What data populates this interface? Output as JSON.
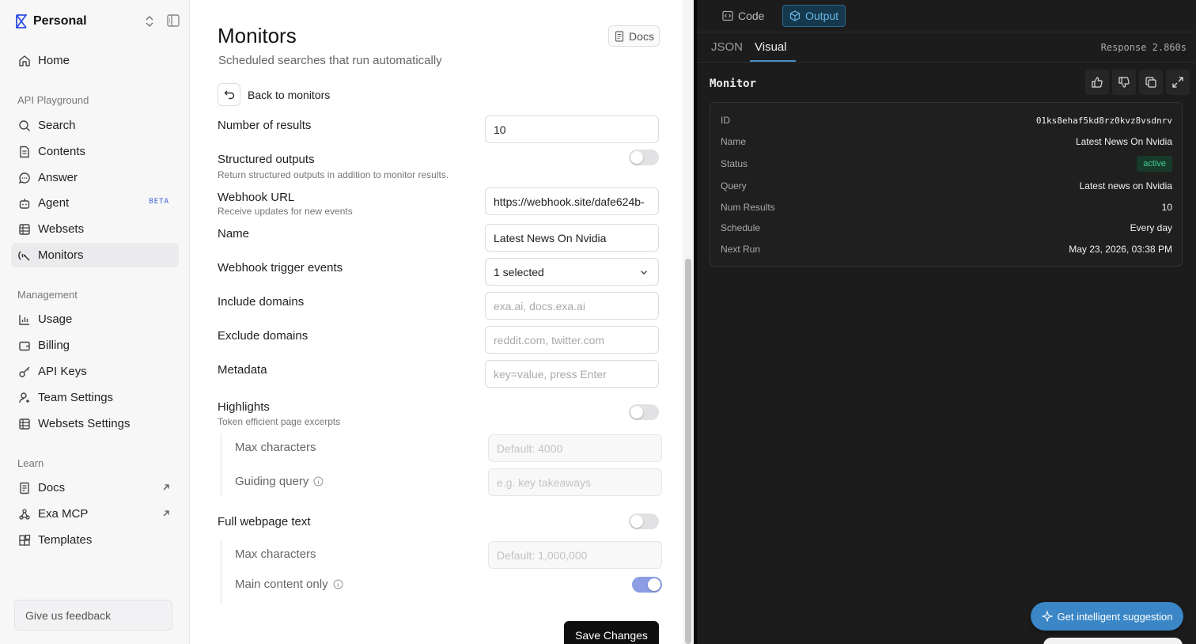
{
  "sidebar": {
    "workspace": "Personal",
    "home": "Home",
    "sections": {
      "api_playground": "API Playground",
      "management": "Management",
      "learn": "Learn"
    },
    "playground_items": [
      {
        "label": "Search"
      },
      {
        "label": "Contents"
      },
      {
        "label": "Answer"
      },
      {
        "label": "Agent",
        "badge": "BETA"
      },
      {
        "label": "Websets"
      },
      {
        "label": "Monitors",
        "active": true
      }
    ],
    "management_items": [
      {
        "label": "Usage"
      },
      {
        "label": "Billing"
      },
      {
        "label": "API Keys"
      },
      {
        "label": "Team Settings"
      },
      {
        "label": "Websets Settings"
      }
    ],
    "learn_items": [
      {
        "label": "Docs"
      },
      {
        "label": "Exa MCP"
      },
      {
        "label": "Templates"
      }
    ],
    "feedback": "Give us feedback"
  },
  "main": {
    "title": "Monitors",
    "subtitle": "Scheduled searches that run automatically",
    "docs_button": "Docs",
    "back_label": "Back to monitors",
    "num_results": {
      "label": "Number of results",
      "value": "10"
    },
    "structured_outputs": {
      "label": "Structured outputs",
      "hint": "Return structured outputs in addition to monitor results.",
      "enabled": false
    },
    "webhook_url": {
      "label": "Webhook URL",
      "hint": "Receive updates for new events",
      "value": "https://webhook.site/dafe624b-"
    },
    "name": {
      "label": "Name",
      "value": "Latest News On Nvidia"
    },
    "trigger_events": {
      "label": "Webhook trigger events",
      "value": "1 selected"
    },
    "include_domains": {
      "label": "Include domains",
      "placeholder": "exa.ai, docs.exa.ai"
    },
    "exclude_domains": {
      "label": "Exclude domains",
      "placeholder": "reddit.com, twitter.com"
    },
    "metadata": {
      "label": "Metadata",
      "placeholder": "key=value, press Enter"
    },
    "highlights": {
      "label": "Highlights",
      "hint": "Token efficient page excerpts",
      "enabled": false,
      "max_chars_label": "Max characters",
      "max_chars_placeholder": "Default: 4000",
      "guiding_query_label": "Guiding query",
      "guiding_query_placeholder": "e.g. key takeaways"
    },
    "full_text": {
      "label": "Full webpage text",
      "enabled": false,
      "max_chars_label": "Max characters",
      "max_chars_placeholder": "Default: 1,000,000",
      "main_content_label": "Main content only",
      "main_content_enabled": true
    },
    "save_button": "Save Changes"
  },
  "output": {
    "tabs": {
      "code": "Code",
      "output": "Output"
    },
    "subtabs": {
      "json": "JSON",
      "visual": "Visual"
    },
    "response": "Response 2.860s",
    "card_title": "Monitor",
    "fields": {
      "id": {
        "key": "ID",
        "value": "01ks8ehaf5kd8rz0kvz8vsdnrv"
      },
      "name": {
        "key": "Name",
        "value": "Latest News On Nvidia"
      },
      "status": {
        "key": "Status",
        "value": "active"
      },
      "query": {
        "key": "Query",
        "value": "Latest news on Nvidia"
      },
      "num_results": {
        "key": "Num Results",
        "value": "10"
      },
      "schedule": {
        "key": "Schedule",
        "value": "Every day"
      },
      "next_run": {
        "key": "Next Run",
        "value": "May 23, 2026, 03:38 PM"
      }
    },
    "suggestion_button": "Get intelligent suggestion"
  },
  "colors": {
    "accent_blue": "#3b5bdb",
    "panel_bg": "#1c1c1c",
    "status_green": "#3ed08a",
    "suggest_button": "#3a86c6"
  }
}
